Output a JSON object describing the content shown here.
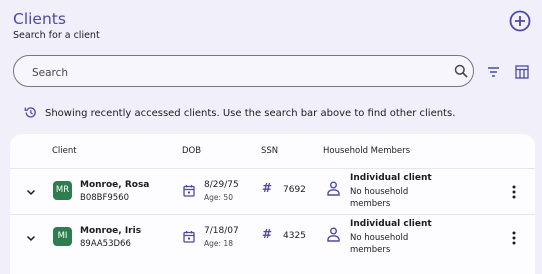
{
  "header": {
    "title": "Clients",
    "subtitle": "Search for a client"
  },
  "search": {
    "placeholder": "Search"
  },
  "notice": "Showing recently accessed clients. Use the search bar above to find other clients.",
  "table": {
    "columns": {
      "client": "Client",
      "dob": "DOB",
      "ssn": "SSN",
      "household": "Household Members"
    },
    "rows": [
      {
        "initials": "MR",
        "name": "Monroe, Rosa",
        "id": "B08BF9560",
        "dob": "8/29/75",
        "age": "Age: 50",
        "ssn": "7692",
        "household_type": "Individual client",
        "household_members": "No household members"
      },
      {
        "initials": "MI",
        "name": "Monroe, Iris",
        "id": "89AA53D66",
        "dob": "7/18/07",
        "age": "Age: 18",
        "ssn": "4325",
        "household_type": "Individual client",
        "household_members": "No household members"
      }
    ]
  },
  "colors": {
    "accent": "#4d4aa5",
    "avatar": "#2e7d4f",
    "background": "#f1eff9"
  },
  "icons": [
    "add-circle-icon",
    "search-icon",
    "filter-icon",
    "columns-icon",
    "history-icon",
    "chevron-down-icon",
    "calendar-icon",
    "hash-icon",
    "person-icon",
    "more-vertical-icon"
  ]
}
